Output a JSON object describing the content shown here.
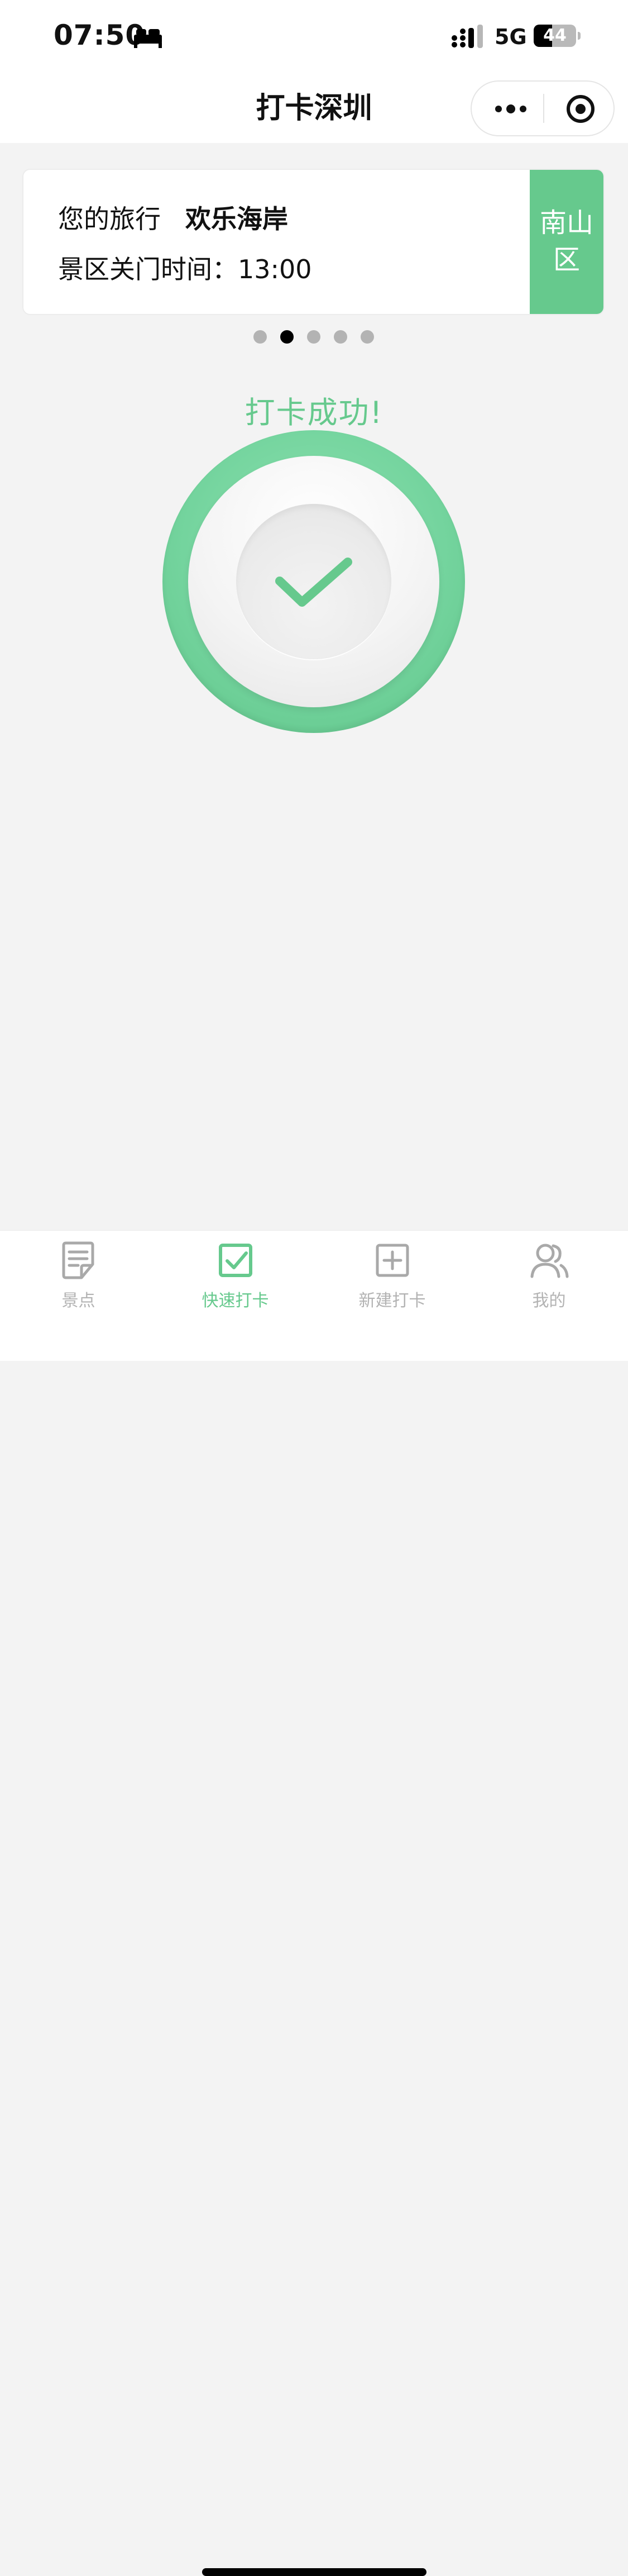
{
  "status_bar": {
    "time": "07:50",
    "sleep_icon": "bed-icon",
    "signal_icon": "cellular-signal-icon",
    "network": "5G",
    "battery_level": "44",
    "battery_fraction": 0.44
  },
  "nav": {
    "title": "打卡深圳",
    "more_icon": "more-dots-icon",
    "close_icon": "target-close-icon"
  },
  "trip_card": {
    "label": "您的旅行",
    "park_name": "欢乐海岸",
    "closing_time": "景区关门时间：13:00",
    "district": "南山区"
  },
  "carousel": {
    "count": 5,
    "active_index": 1
  },
  "checkin": {
    "success_text": "打卡成功!",
    "check_icon": "checkmark-icon"
  },
  "tabs": [
    {
      "label": "景点",
      "icon": "document-icon",
      "active": false
    },
    {
      "label": "快速打卡",
      "icon": "checkbox-icon",
      "active": true
    },
    {
      "label": "新建打卡",
      "icon": "add-square-icon",
      "active": false
    },
    {
      "label": "我的",
      "icon": "users-icon",
      "active": false
    }
  ],
  "colors": {
    "accent": "#66c98d",
    "inactive": "#b3b3b3",
    "background": "#f3f3f3"
  }
}
